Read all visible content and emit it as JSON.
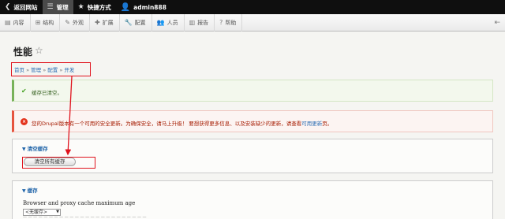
{
  "toolbar": {
    "back": {
      "label": "返回网站",
      "icon": "chevron-left-circle-icon"
    },
    "manage": {
      "label": "管理",
      "icon": "menu-icon"
    },
    "shortcuts": {
      "label": "快捷方式",
      "icon": "star-icon"
    },
    "user": {
      "label": "admin888",
      "icon": "user-icon"
    }
  },
  "tray": {
    "items": [
      {
        "label": "内容",
        "icon": "content-icon"
      },
      {
        "label": "结构",
        "icon": "structure-icon"
      },
      {
        "label": "外观",
        "icon": "appearance-icon"
      },
      {
        "label": "扩展",
        "icon": "puzzle-icon"
      },
      {
        "label": "配置",
        "icon": "wrench-icon"
      },
      {
        "label": "人员",
        "icon": "people-icon"
      },
      {
        "label": "报告",
        "icon": "chart-icon"
      },
      {
        "label": "帮助",
        "icon": "help-icon"
      }
    ]
  },
  "page": {
    "title": "性能"
  },
  "breadcrumb": {
    "items": [
      "首页",
      "管理",
      "配置",
      "开发"
    ],
    "separator": "»"
  },
  "messages": {
    "status": "缓存已清空。",
    "error_prefix": "您的Drupal版本有一个可用的安全更新。为确保安全，请马上升级！ 要想获得更多信息、以及安装缺少的更新，请查看",
    "error_link": "可用更新",
    "error_suffix": "页。"
  },
  "clear_cache": {
    "legend": "清空缓存",
    "button_label": "清空所有缓存"
  },
  "cache": {
    "legend": "缓存",
    "field_label": "Browser and proxy cache maximum age",
    "select_value": "<无缓存>"
  },
  "colors": {
    "toolbar_bg": "#0f0f0f",
    "annotation": "#e0141e",
    "link": "#2a6db3",
    "error": "#e6533e",
    "status": "#77b259"
  }
}
